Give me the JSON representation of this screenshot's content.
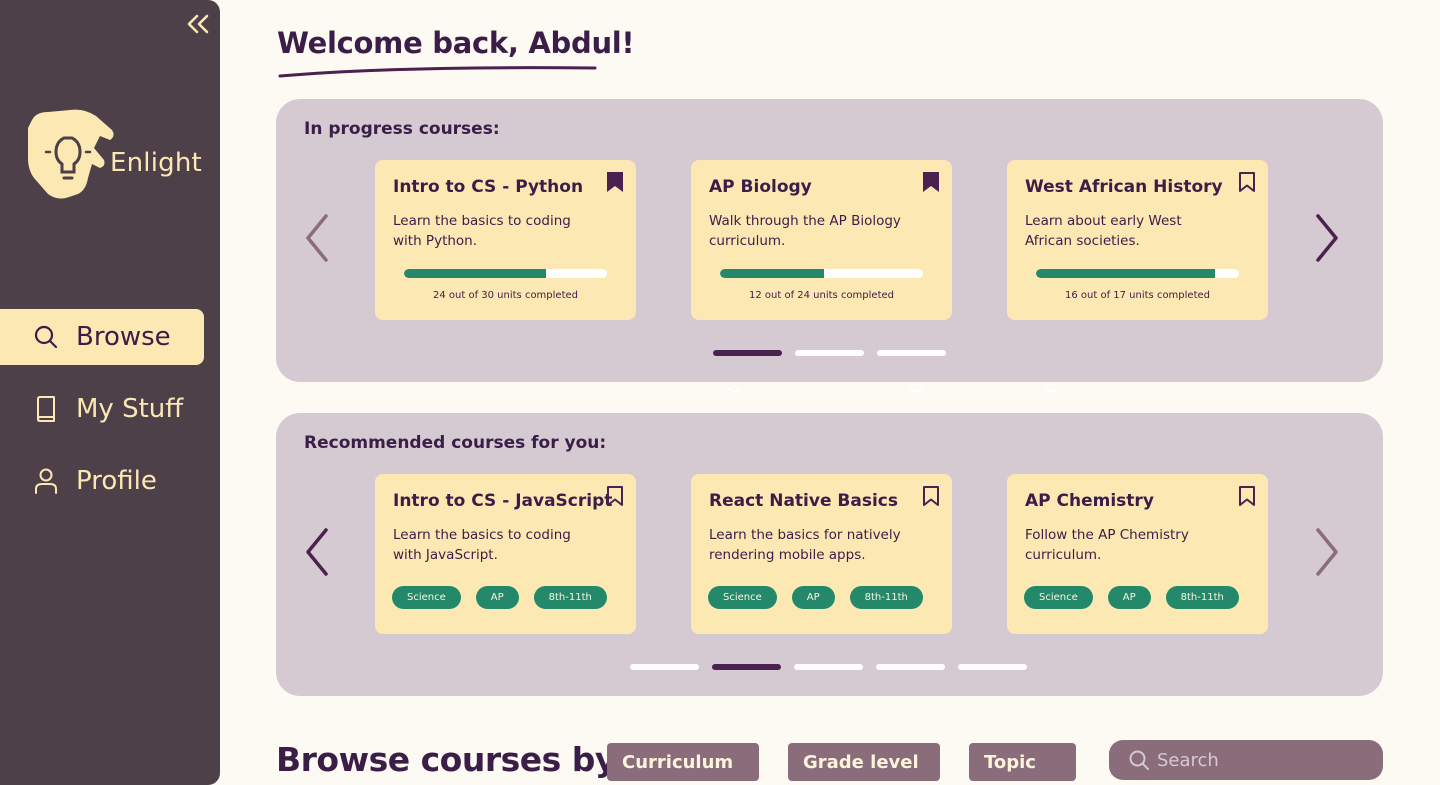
{
  "app": {
    "name": "Enlight"
  },
  "sidebar": {
    "collapse_icon": "chevrons-left-icon",
    "items": [
      {
        "label": "Browse",
        "icon": "search-icon",
        "active": true
      },
      {
        "label": "My Stuff",
        "icon": "book-icon",
        "active": false
      },
      {
        "label": "Profile",
        "icon": "user-icon",
        "active": false
      }
    ]
  },
  "main": {
    "welcome": "Welcome back, Abdul!"
  },
  "in_progress": {
    "title": "In progress courses:",
    "courses": [
      {
        "title": "Intro to CS - Python",
        "description": "Learn the basics to coding with Python.",
        "bookmarked": true,
        "progress": 0.7,
        "progress_text": "24 out of 30 units completed"
      },
      {
        "title": "AP Biology",
        "description": "Walk through the AP Biology curriculum.",
        "bookmarked": true,
        "progress": 0.51,
        "progress_text": "12 out of 24 units completed"
      },
      {
        "title": "West African History",
        "description": "Learn about early West African societies.",
        "bookmarked": false,
        "progress": 0.88,
        "progress_text": "16 out of 17 units completed"
      }
    ],
    "pages": 3,
    "active_page": 0
  },
  "recommended": {
    "title": "Recommended courses for you:",
    "courses": [
      {
        "title": "Intro to CS - JavaScript",
        "description": "Learn the basics to coding with JavaScript.",
        "bookmarked": false,
        "tags": [
          "Science",
          "AP",
          "8th-11th"
        ]
      },
      {
        "title": "React Native Basics",
        "description": "Learn the basics for natively rendering mobile apps.",
        "bookmarked": false,
        "tags": [
          "Science",
          "AP",
          "8th-11th"
        ]
      },
      {
        "title": "AP Chemistry",
        "description": "Follow the AP Chemistry curriculum.",
        "bookmarked": false,
        "tags": [
          "Science",
          "AP",
          "8th-11th"
        ]
      }
    ],
    "pages": 5,
    "active_page": 1
  },
  "browse": {
    "title": "Browse courses by...",
    "filters": [
      "Curriculum",
      "Grade level",
      "Topic"
    ],
    "search_placeholder": "Search"
  },
  "colors": {
    "sidebar": "#4d4049",
    "cream": "#fbe8b3",
    "plum": "#3a1e48",
    "panel": "#d6cad2",
    "green": "#23896a",
    "mauve": "#8a6c7b"
  }
}
